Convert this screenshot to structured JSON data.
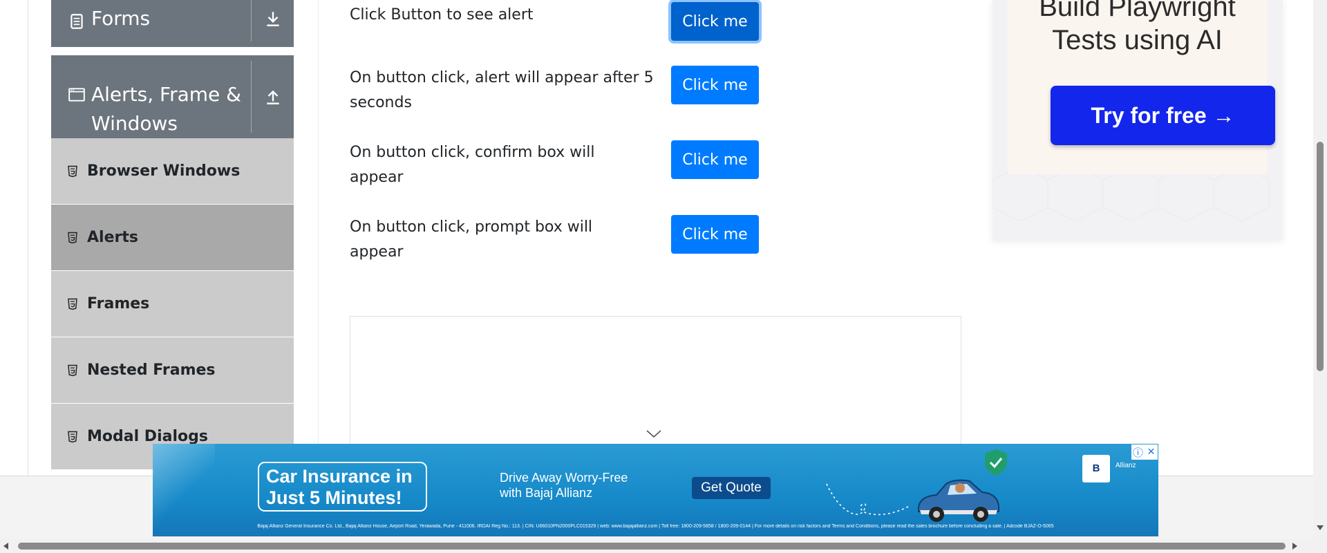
{
  "sidebar": {
    "forms_label": "Forms",
    "alerts_group_label": "Alerts, Frame & Windows",
    "items": [
      {
        "label": "Browser Windows"
      },
      {
        "label": "Alerts"
      },
      {
        "label": "Frames"
      },
      {
        "label": "Nested Frames"
      },
      {
        "label": "Modal Dialogs"
      }
    ],
    "active_item": "Alerts"
  },
  "main": {
    "rows": [
      {
        "text": "Click Button to see alert",
        "button": "Click me"
      },
      {
        "text": "On button click, alert will appear after 5 seconds",
        "button": "Click me"
      },
      {
        "text": "On button click, confirm box will appear",
        "button": "Click me"
      },
      {
        "text": "On button click, prompt box will appear",
        "button": "Click me"
      }
    ]
  },
  "right_ad": {
    "headline": "Build Playwright Tests using AI",
    "cta": "Try for free →"
  },
  "banner_ad": {
    "offer": "Car Insurance in Just 5 Minutes!",
    "tagline": "Drive Away Worry-Free with Bajaj Allianz",
    "cta": "Get Quote",
    "logo": "B",
    "logo_sub": "Allianz",
    "fine_print": "Bajaj Allianz General Insurance Co. Ltd., Bajaj Allianz House, Airport Road, Yerawada, Pune - 411006. IRDAI Reg No.: 113. | CIN: U66010PN2000PLC015329 | web: www.bajajallianz.com | Toll free: 1800-209-5858 / 1800-209-0144 | For more details on risk factors and Terms and Conditions, please read the sales brochure before concluding a sale. | Adcode BJAZ-O-5065",
    "info_icon": "ⓘ",
    "close_icon": "✕"
  },
  "colors": {
    "primary_button": "#007bff",
    "sidebar_header": "#6c757d",
    "sidebar_item": "#cbcbcb",
    "sidebar_item_active": "#a9a9a9",
    "right_ad_cta": "#1326ec",
    "banner": "#1689c9"
  }
}
